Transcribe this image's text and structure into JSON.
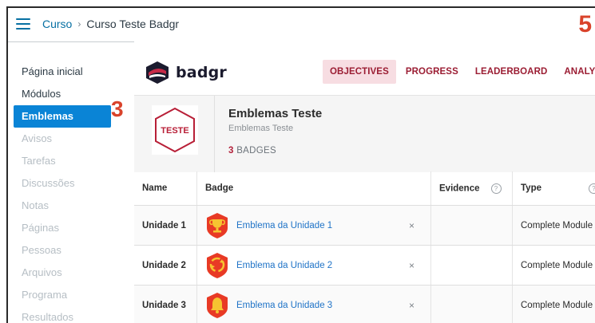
{
  "annotations": {
    "top_right": "5",
    "sidebar": "3"
  },
  "breadcrumb": {
    "course_link": "Curso",
    "separator": "›",
    "current": "Curso Teste Badgr"
  },
  "sidebar": {
    "items": [
      {
        "label": "Página inicial",
        "state": "enabled"
      },
      {
        "label": "Módulos",
        "state": "enabled"
      },
      {
        "label": "Emblemas",
        "state": "active"
      },
      {
        "label": "Avisos",
        "state": "disabled"
      },
      {
        "label": "Tarefas",
        "state": "disabled"
      },
      {
        "label": "Discussões",
        "state": "disabled"
      },
      {
        "label": "Notas",
        "state": "disabled"
      },
      {
        "label": "Páginas",
        "state": "disabled"
      },
      {
        "label": "Pessoas",
        "state": "disabled"
      },
      {
        "label": "Arquivos",
        "state": "disabled"
      },
      {
        "label": "Programa",
        "state": "disabled"
      },
      {
        "label": "Resultados",
        "state": "disabled"
      }
    ]
  },
  "badgr": {
    "logo_text": "badgr",
    "tabs": [
      {
        "label": "OBJECTIVES",
        "active": true
      },
      {
        "label": "PROGRESS",
        "active": false
      },
      {
        "label": "LEADERBOARD",
        "active": false
      },
      {
        "label": "ANALYTICS",
        "active": false
      }
    ]
  },
  "collection": {
    "image_text": "TESTE",
    "title": "Emblemas Teste",
    "subtitle": "Emblemas Teste",
    "count": "3",
    "count_label": "BADGES"
  },
  "table": {
    "headers": {
      "name": "Name",
      "badge": "Badge",
      "evidence": "Evidence",
      "type": "Type",
      "help_glyph": "?"
    },
    "rows": [
      {
        "name": "Unidade 1",
        "badge": "Emblema da Unidade 1",
        "icon": "trophy-icon",
        "remove": "×",
        "type": "Complete Module"
      },
      {
        "name": "Unidade 2",
        "badge": "Emblema da Unidade 2",
        "icon": "recycle-icon",
        "remove": "×",
        "type": "Complete Module"
      },
      {
        "name": "Unidade 3",
        "badge": "Emblema da Unidade 3",
        "icon": "bell-icon",
        "remove": "×",
        "type": "Complete Module"
      }
    ]
  },
  "colors": {
    "accent": "#0770a3",
    "active_nav": "#0a84d6",
    "badgr_red": "#9b1d33",
    "annotation": "#d9432b"
  }
}
